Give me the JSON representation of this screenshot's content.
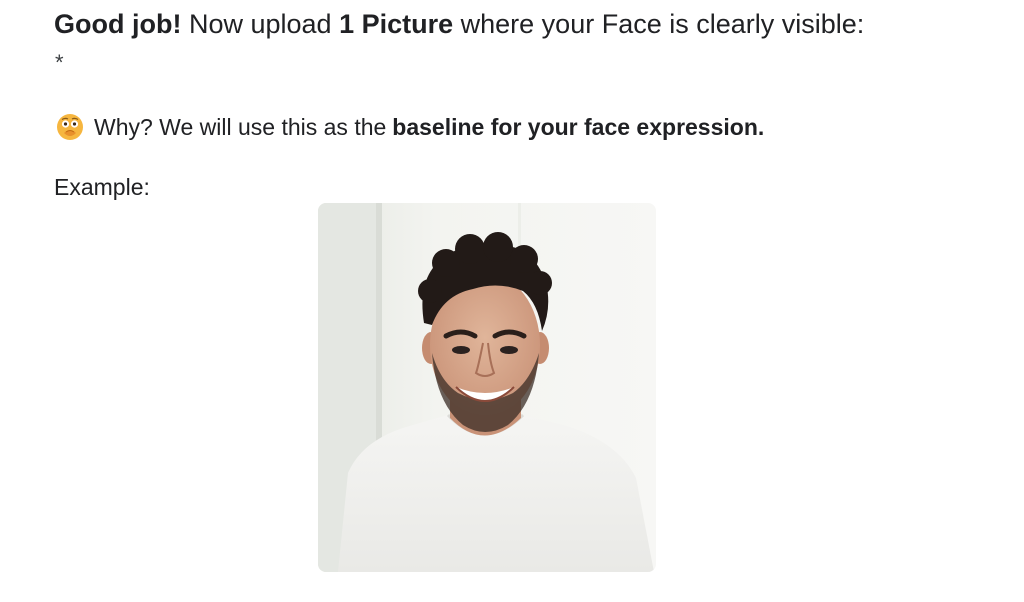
{
  "question": {
    "part1_bold": "Good job!",
    "part2": " Now upload ",
    "part3_bold": "1 Picture",
    "part4": " where your Face is clearly visible:",
    "required_mark": "*"
  },
  "why": {
    "emoji": "face-with-hand-over-mouth-emoji",
    "text": "Why? We will use this as the",
    "bold": "baseline for your face expression."
  },
  "example": {
    "label": "Example:",
    "image": "smiling-man-portrait"
  }
}
